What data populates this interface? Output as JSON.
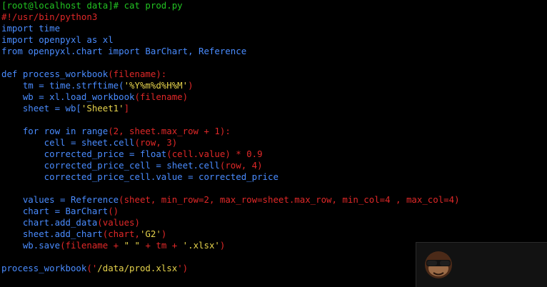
{
  "terminal": {
    "lines": [
      [
        {
          "t": "[root@localhost data]# cat prod.py",
          "c": "g"
        }
      ],
      [
        {
          "t": "#!/usr/bin/python3",
          "c": "r"
        }
      ],
      [
        {
          "t": "import time",
          "c": "b"
        }
      ],
      [
        {
          "t": "import openpyxl as xl",
          "c": "b"
        }
      ],
      [
        {
          "t": "from openpyxl.chart import BarChart, Reference",
          "c": "b"
        }
      ],
      [],
      [
        {
          "t": "def process_workbook",
          "c": "b"
        },
        {
          "t": "(filename):",
          "c": "r"
        }
      ],
      [
        {
          "t": "    tm = time.strftime(",
          "c": "b"
        },
        {
          "t": "'%Y%m%d%H%M'",
          "c": "y"
        },
        {
          "t": ")",
          "c": "r"
        }
      ],
      [
        {
          "t": "    wb = xl.load_workbook",
          "c": "b"
        },
        {
          "t": "(filename)",
          "c": "r"
        }
      ],
      [
        {
          "t": "    sheet = wb[",
          "c": "b"
        },
        {
          "t": "'Sheet1'",
          "c": "y"
        },
        {
          "t": "]",
          "c": "r"
        }
      ],
      [],
      [
        {
          "t": "    for row in range",
          "c": "b"
        },
        {
          "t": "(2, sheet.max_row + 1):",
          "c": "r"
        }
      ],
      [
        {
          "t": "        cell = sheet.cell",
          "c": "b"
        },
        {
          "t": "(row, 3)",
          "c": "r"
        }
      ],
      [
        {
          "t": "        corrected_price = float",
          "c": "b"
        },
        {
          "t": "(cell.value) * 0.9",
          "c": "r"
        }
      ],
      [
        {
          "t": "        corrected_price_cell = sheet.cell",
          "c": "b"
        },
        {
          "t": "(row, 4)",
          "c": "r"
        }
      ],
      [
        {
          "t": "        corrected_price_cell.value = corrected_price",
          "c": "b"
        }
      ],
      [],
      [
        {
          "t": "    values = Reference",
          "c": "b"
        },
        {
          "t": "(sheet, min_row=2, max_row=sheet.max_row, min_col=4 , max_col=4)",
          "c": "r"
        }
      ],
      [
        {
          "t": "    chart = BarChart",
          "c": "b"
        },
        {
          "t": "()",
          "c": "r"
        }
      ],
      [
        {
          "t": "    chart.add_data",
          "c": "b"
        },
        {
          "t": "(values)",
          "c": "r"
        }
      ],
      [
        {
          "t": "    sheet.add_chart",
          "c": "b"
        },
        {
          "t": "(chart,",
          "c": "r"
        },
        {
          "t": "'G2'",
          "c": "y"
        },
        {
          "t": ")",
          "c": "r"
        }
      ],
      [
        {
          "t": "    wb.save",
          "c": "b"
        },
        {
          "t": "(filename + ",
          "c": "r"
        },
        {
          "t": "\" \"",
          "c": "y"
        },
        {
          "t": " + tm + ",
          "c": "r"
        },
        {
          "t": "'.xlsx'",
          "c": "y"
        },
        {
          "t": ")",
          "c": "r"
        }
      ],
      [],
      [
        {
          "t": "process_workbook",
          "c": "b"
        },
        {
          "t": "('",
          "c": "r"
        },
        {
          "t": "/data/prod.xlsx",
          "c": "y"
        },
        {
          "t": "')",
          "c": "r"
        }
      ]
    ]
  },
  "colors": {
    "background": "#000000",
    "prompt": "#22c322",
    "keyword": "#4a8cff",
    "punctuation": "#e02828",
    "string": "#e6d34c"
  },
  "watermark": {
    "icon": "monkey-sunglasses-icon"
  }
}
